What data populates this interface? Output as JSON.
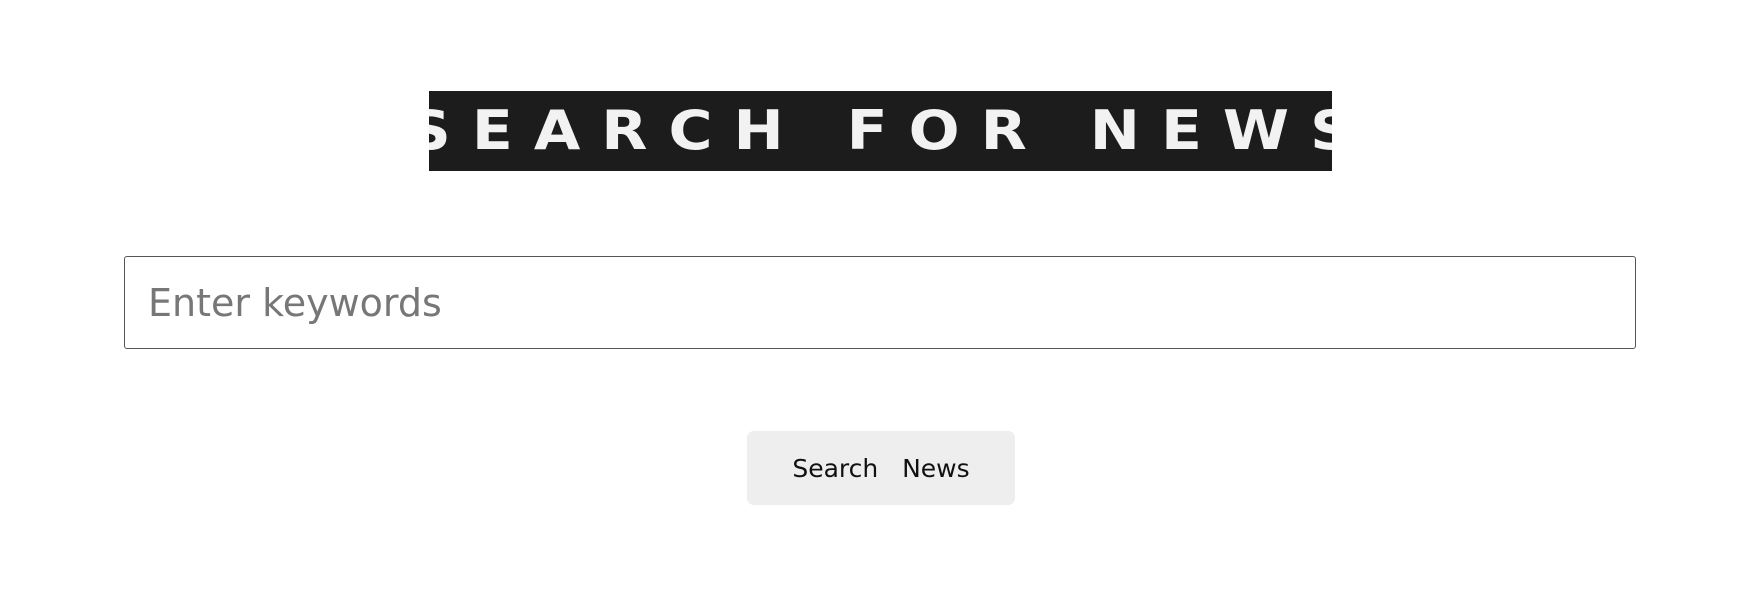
{
  "header": {
    "banner_text": "SEARCH FOR NEWS"
  },
  "search": {
    "placeholder": "Enter keywords",
    "value": ""
  },
  "actions": {
    "search_button_label": "Search   News"
  },
  "colors": {
    "banner_background": "#1c1c1c",
    "banner_text": "#f2f2f2",
    "button_background": "#eeeeee",
    "input_border": "#555555",
    "placeholder": "#777777"
  }
}
